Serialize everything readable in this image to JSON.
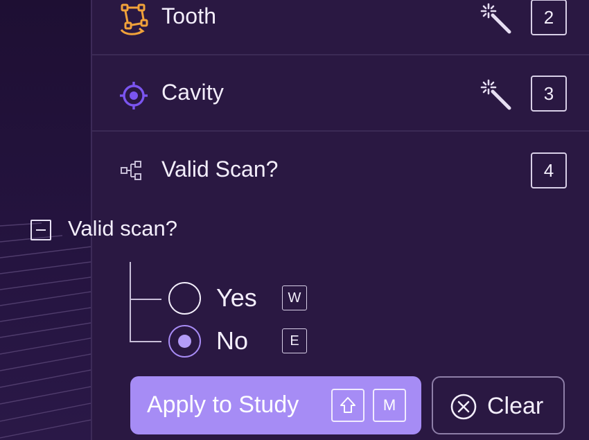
{
  "tools": [
    {
      "label": "Tooth",
      "shortcut": "2",
      "icon": "polygon-icon",
      "icon_color": "#f1a23a",
      "has_magic": true
    },
    {
      "label": "Cavity",
      "shortcut": "3",
      "icon": "target-icon",
      "icon_color": "#7b55f0",
      "has_magic": true
    }
  ],
  "classification": {
    "label": "Valid Scan?",
    "shortcut": "4",
    "icon": "hierarchy-icon"
  },
  "question": {
    "label": "Valid scan?",
    "options": [
      {
        "label": "Yes",
        "key": "W",
        "selected": false
      },
      {
        "label": "No",
        "key": "E",
        "selected": true
      }
    ]
  },
  "actions": {
    "apply_label": "Apply to Study",
    "apply_key_mod": "shift-icon",
    "apply_key": "M",
    "clear_label": "Clear"
  },
  "colors": {
    "accent": "#a68cf5",
    "panel_bg": "#2a1842"
  }
}
